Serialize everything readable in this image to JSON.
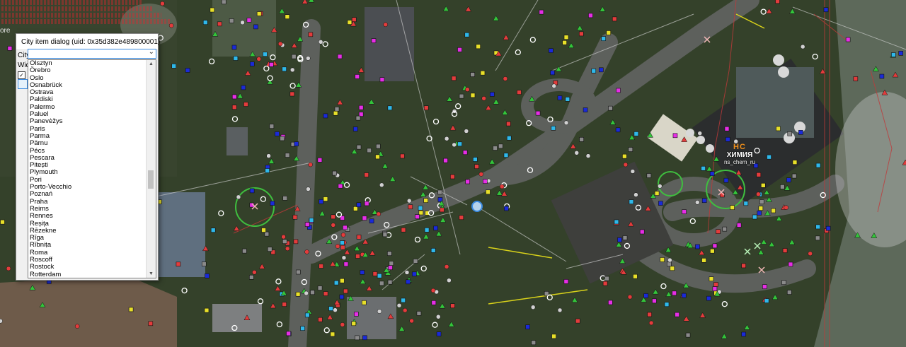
{
  "dialog": {
    "title": "City item dialog (uid: 0x35d382e489800001)",
    "city_label": "City",
    "city_value": "",
    "partial_label": "Wid",
    "checkbox_mark": "✓",
    "cities": [
      "Olsztyn",
      "Örebro",
      "Oslo",
      "Osnabrück",
      "Ostrava",
      "Paldiski",
      "Palermo",
      "Paluel",
      "Panevėžys",
      "Paris",
      "Parma",
      "Pärnu",
      "Pécs",
      "Pescara",
      "Pitești",
      "Plymouth",
      "Pori",
      "Porto-Vecchio",
      "Poznań",
      "Praha",
      "Reims",
      "Rennes",
      "Reșița",
      "Rēzekne",
      "Rīga",
      "Rībniṭa",
      "Roma",
      "Roscoff",
      "Rostock",
      "Rotterdam"
    ]
  },
  "overlay": {
    "side_text": "ore",
    "logo_brand": "HC",
    "logo_text": "ХИМИЯ",
    "logo_sub": "ns_chem_ru"
  },
  "colors": {
    "dialog_bg": "#f0f0f0",
    "accent": "#3b8be0",
    "debug_red": "#e0262f",
    "logo_orange": "#f08f1a"
  }
}
